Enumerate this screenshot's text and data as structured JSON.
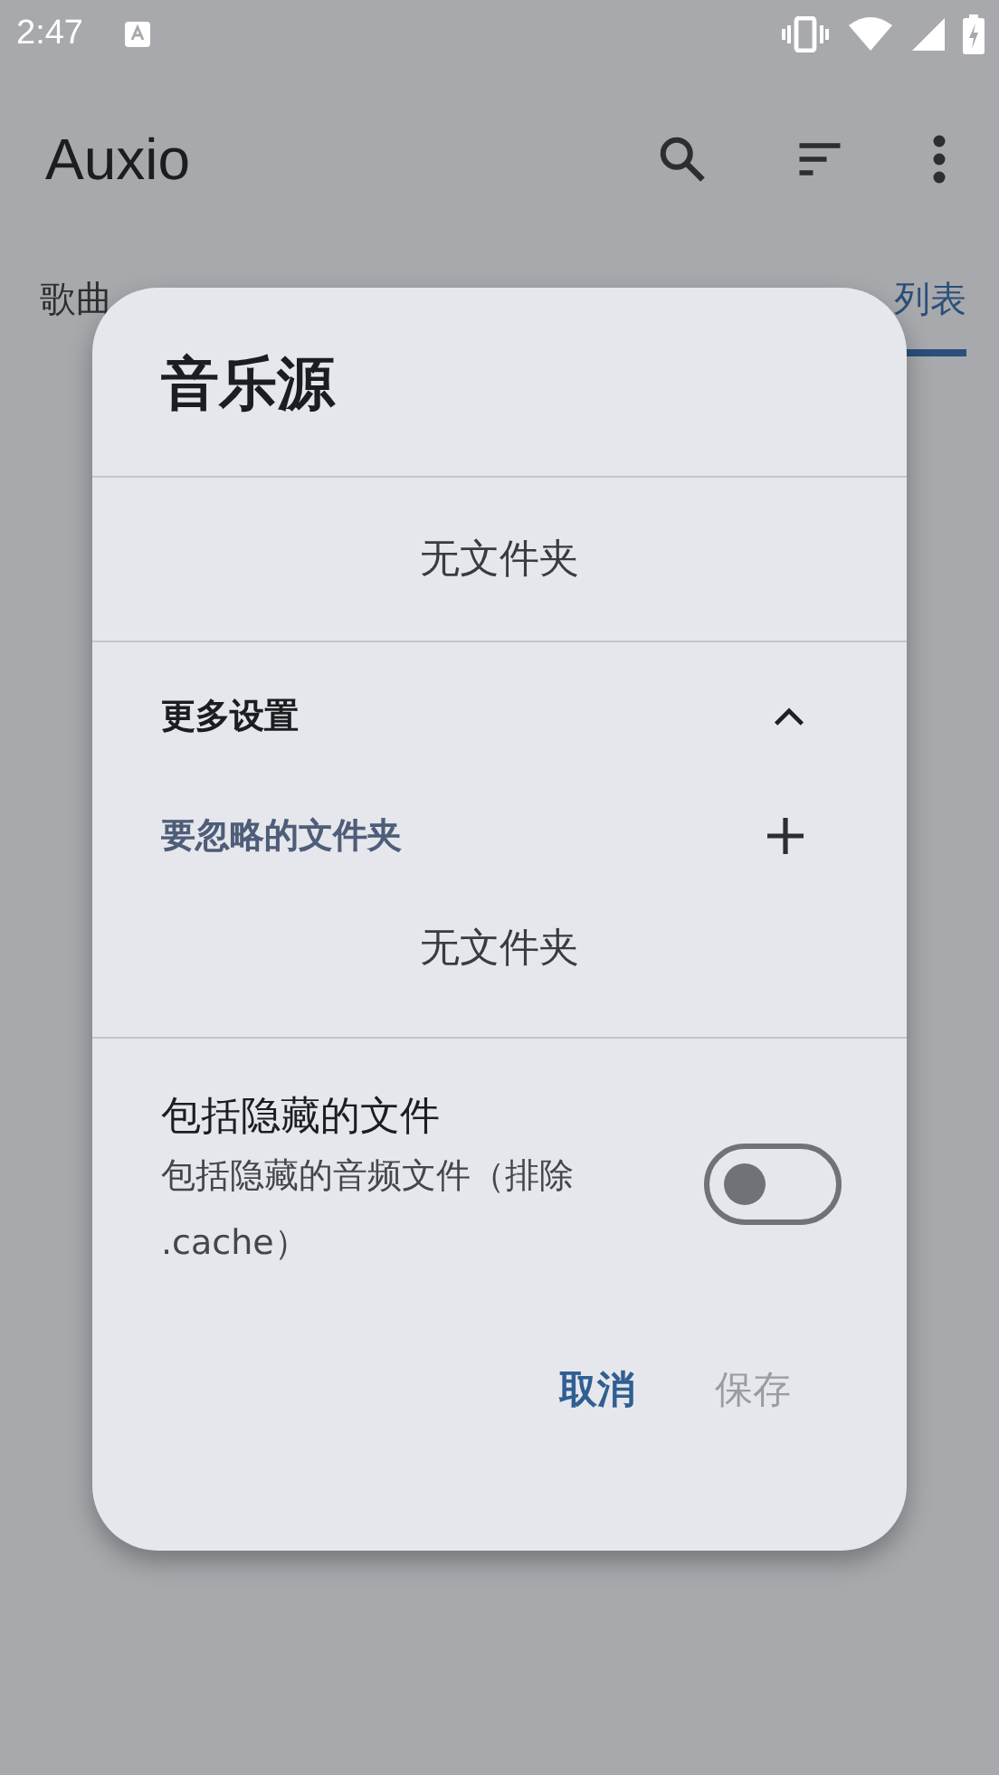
{
  "status_bar": {
    "time": "2:47"
  },
  "app_bar": {
    "title": "Auxio"
  },
  "tabs": [
    {
      "label": "歌曲",
      "selected": false
    },
    {
      "label": "列表",
      "selected": true
    }
  ],
  "dialog": {
    "title": "音乐源",
    "folders": {
      "empty_text": "无文件夹"
    },
    "more_settings": {
      "label": "更多设置",
      "expanded": true
    },
    "excluded": {
      "label": "要忽略的文件夹",
      "empty_text": "无文件夹"
    },
    "hidden_files": {
      "title": "包括隐藏的文件",
      "subtitle": "包括隐藏的音频文件（排除 .cache）",
      "on": false
    },
    "buttons": [
      {
        "label": "取消",
        "disabled": false
      },
      {
        "label": "保存",
        "disabled": true
      }
    ]
  }
}
